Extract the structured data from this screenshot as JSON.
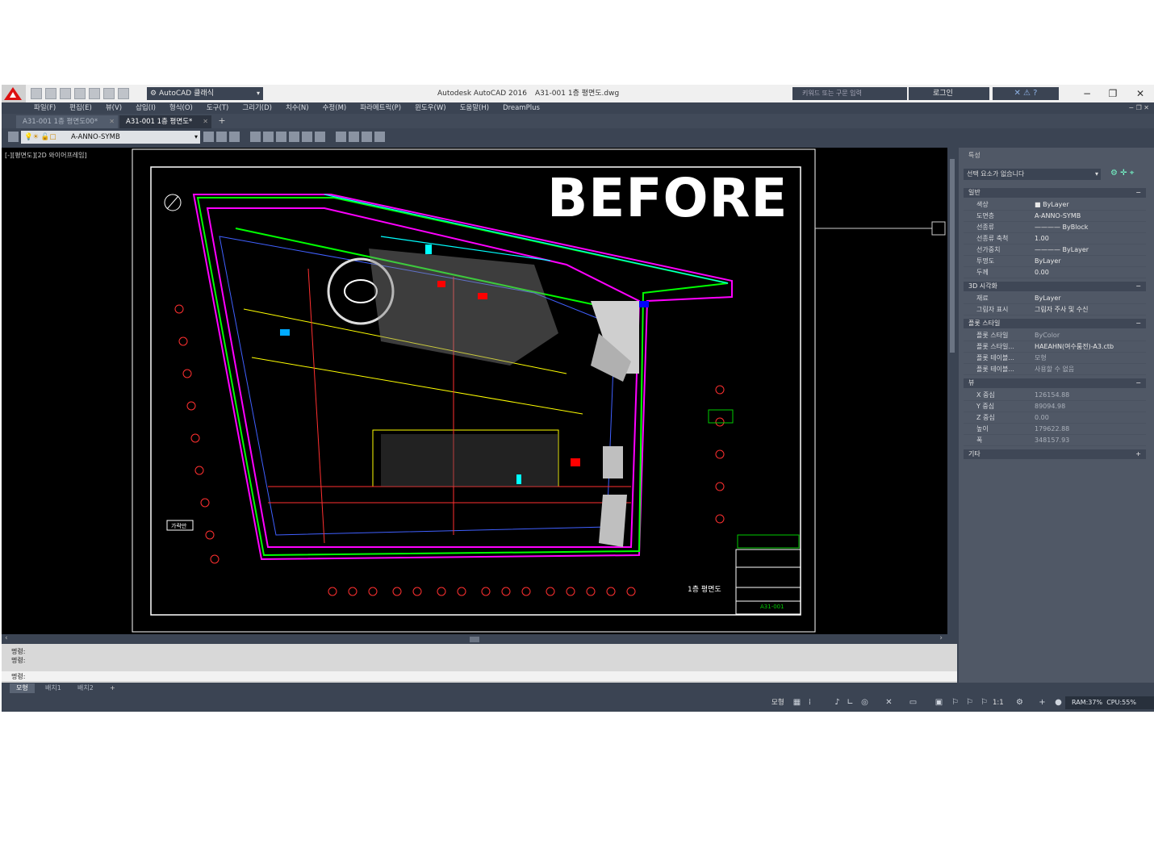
{
  "app": {
    "title": "Autodesk AutoCAD 2016",
    "file": "A31-001 1층 평면도.dwg",
    "workspace": "AutoCAD 클래식",
    "search_placeholder": "키워드 또는 구문 입력",
    "login": "로그인"
  },
  "menu": [
    "파일(F)",
    "편집(E)",
    "뷰(V)",
    "삽입(I)",
    "형식(O)",
    "도구(T)",
    "그리기(D)",
    "치수(N)",
    "수정(M)",
    "파라메트릭(P)",
    "윈도우(W)",
    "도움말(H)",
    "DreamPlus"
  ],
  "tabs": [
    {
      "label": "A31-001 1층 평면도00*"
    },
    {
      "label": "A31-001 1층 평면도*"
    }
  ],
  "layer": {
    "current": "A-ANNO-SYMB"
  },
  "viewport": {
    "label": "[-][평면도][2D 와이어프레임]",
    "overlay_text": "BEFORE",
    "sheet_title": "1층 평면도",
    "sheet_no": "A31-001",
    "keyplan_label": "가락만"
  },
  "properties": {
    "header": "특성",
    "selection": "선택 요소가 없습니다",
    "sections": [
      {
        "name": "일반",
        "toggle": "−",
        "rows": [
          {
            "key": "색상",
            "value": "■ ByLayer"
          },
          {
            "key": "도면층",
            "value": "A-ANNO-SYMB"
          },
          {
            "key": "선종류",
            "value": "———— ByBlock"
          },
          {
            "key": "선종류 축척",
            "value": "1.00"
          },
          {
            "key": "선가중치",
            "value": "———— ByLayer"
          },
          {
            "key": "투명도",
            "value": "ByLayer"
          },
          {
            "key": "두께",
            "value": "0.00"
          }
        ]
      },
      {
        "name": "3D 시각화",
        "toggle": "−",
        "rows": [
          {
            "key": "재료",
            "value": "ByLayer"
          },
          {
            "key": "그림자 표시",
            "value": "그림자 주사 및 수신"
          }
        ]
      },
      {
        "name": "플롯 스타일",
        "toggle": "−",
        "rows": [
          {
            "key": "플롯 스타일",
            "value": "ByColor"
          },
          {
            "key": "플롯 스타일...",
            "value": "HAEAHN(여수룸전)-A3.ctb"
          },
          {
            "key": "플롯 테이블...",
            "value": "모형"
          },
          {
            "key": "플롯 테이블...",
            "value": "사용할 수 없음"
          }
        ]
      },
      {
        "name": "뷰",
        "toggle": "−",
        "rows": [
          {
            "key": "X 중심",
            "value": "126154.88"
          },
          {
            "key": "Y 중심",
            "value": "89094.98"
          },
          {
            "key": "Z 중심",
            "value": "0.00"
          },
          {
            "key": "높이",
            "value": "179622.88"
          },
          {
            "key": "폭",
            "value": "348157.93"
          }
        ]
      },
      {
        "name": "기타",
        "toggle": "+",
        "rows": []
      }
    ]
  },
  "command": {
    "lines": [
      "명령:",
      "명령:",
      "명령:"
    ]
  },
  "layout_tabs": [
    "모형",
    "배치1",
    "배치2",
    "+"
  ],
  "status": {
    "model": "모형",
    "scale": "1:1",
    "ram": "RAM:37%",
    "cpu": "CPU:55%"
  },
  "colors": {
    "title_bg": "#f0f0f0",
    "chrome": "#3b4453",
    "canvas": "#000000",
    "magenta": "#ff00ff",
    "green": "#00ff00",
    "accent_red": "#cc0000"
  }
}
